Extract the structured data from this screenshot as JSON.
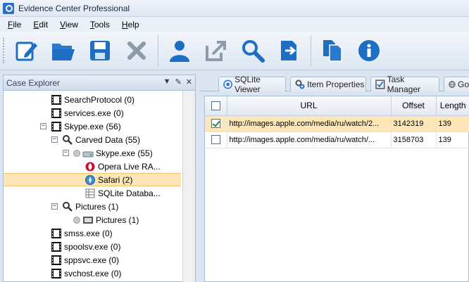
{
  "window": {
    "title": "Evidence Center Professional"
  },
  "menu": [
    {
      "label": "File",
      "accel": "F",
      "rest": "ile"
    },
    {
      "label": "Edit",
      "accel": "E",
      "rest": "dit"
    },
    {
      "label": "View",
      "accel": "V",
      "rest": "iew"
    },
    {
      "label": "Tools",
      "accel": "T",
      "rest": "ools"
    },
    {
      "label": "Help",
      "accel": "H",
      "rest": "elp"
    }
  ],
  "toolbar": {
    "icons": [
      "edit-icon",
      "open-folder-icon",
      "save-icon",
      "delete-icon",
      "user-icon",
      "export-icon",
      "search-icon",
      "forward-icon",
      "copy-icon",
      "info-icon"
    ]
  },
  "case_explorer": {
    "title": "Case Explorer",
    "tree": [
      {
        "label": "SearchProtocol (0)",
        "depth": 3,
        "icon": "film",
        "toggle": ""
      },
      {
        "label": "services.exe (0)",
        "depth": 3,
        "icon": "film",
        "toggle": ""
      },
      {
        "label": "Skype.exe (56)",
        "depth": 3,
        "icon": "film",
        "toggle": "−"
      },
      {
        "label": "Carved Data (55)",
        "depth": 4,
        "icon": "magnifier",
        "toggle": "−"
      },
      {
        "label": "Skype.exe (55)",
        "depth": 5,
        "icon": "drive",
        "toggle": "−"
      },
      {
        "label": "Opera Live RA...",
        "depth": 6,
        "icon": "opera",
        "toggle": ""
      },
      {
        "label": "Safari (2)",
        "depth": 6,
        "icon": "safari",
        "toggle": "",
        "selected": true
      },
      {
        "label": "SQLite Databa...",
        "depth": 6,
        "icon": "database",
        "toggle": ""
      },
      {
        "label": "Pictures (1)",
        "depth": 4,
        "icon": "magnifier",
        "toggle": "−"
      },
      {
        "label": "Pictures (1)",
        "depth": 5,
        "icon": "pictures",
        "toggle": ""
      },
      {
        "label": "smss.exe (0)",
        "depth": 3,
        "icon": "film",
        "toggle": ""
      },
      {
        "label": "spoolsv.exe (0)",
        "depth": 3,
        "icon": "film",
        "toggle": ""
      },
      {
        "label": "sppsvc.exe (0)",
        "depth": 3,
        "icon": "film",
        "toggle": ""
      },
      {
        "label": "svchost.exe (0)",
        "depth": 3,
        "icon": "film",
        "toggle": ""
      }
    ]
  },
  "tabs": [
    {
      "label": "SQLite Viewer",
      "icon": "sqlite-viewer-icon"
    },
    {
      "label": "Item Properties",
      "icon": "gears-icon"
    },
    {
      "label": "Task Manager",
      "icon": "task-manager-icon"
    },
    {
      "label": "Go",
      "icon": "globe-icon"
    }
  ],
  "grid": {
    "columns": [
      "",
      "URL",
      "Offset",
      "Length"
    ],
    "rows": [
      {
        "checked": true,
        "url": "http://images.apple.com/media/ru/watch/2...",
        "offset": "3142319",
        "length": "139",
        "selected": true
      },
      {
        "checked": false,
        "url": "http://images.apple.com/media/ru/watch/...",
        "offset": "3158703",
        "length": "139",
        "selected": false
      }
    ]
  },
  "colors": {
    "selection": "#fde7b8",
    "accent": "#2a6fc9",
    "chrome": "#dbe5f1"
  }
}
